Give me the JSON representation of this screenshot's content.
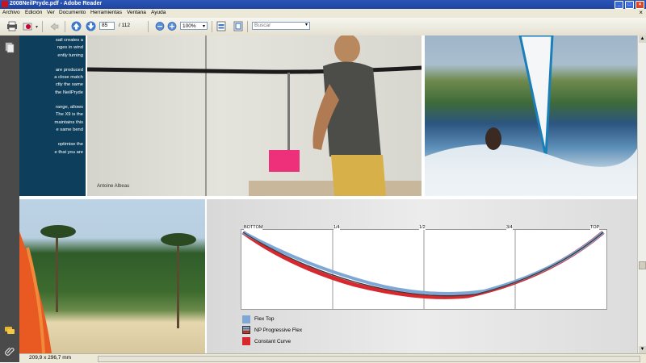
{
  "window": {
    "title": "2008NeilPryde.pdf - Adobe Reader"
  },
  "menu": [
    "Archivo",
    "Edición",
    "Ver",
    "Documento",
    "Herramientas",
    "Ventana",
    "Ayuda"
  ],
  "toolbar": {
    "page_current": "85",
    "page_total": "/ 112",
    "zoom": "100%",
    "search_placeholder": "Buscar"
  },
  "document": {
    "text_lines": [
      "sail creates a",
      "nges in wind",
      "ently turning",
      "are produced",
      "a close match",
      "ctly the same",
      "the NeilPryde",
      "range, allows",
      "The X9 is the",
      "maintains this",
      "e same bend",
      "optimise the",
      "e that you are"
    ],
    "photo_caption": "Antoine Albeau",
    "flex_chart": {
      "labels": [
        "BOTTOM",
        "1/4",
        "1/2",
        "3/4",
        "TOP"
      ],
      "legend": [
        {
          "label": "Flex Top",
          "color": "#7fa7d6"
        },
        {
          "label": "NP Progressive Flex",
          "color": "#6b6b6b"
        },
        {
          "label": "Constant Curve",
          "color": "#d7282f"
        }
      ]
    }
  },
  "status": {
    "page_size": "209,9 x 296,7 mm"
  },
  "colors": {
    "panel_navy": "#0d3f5c",
    "title_blue": "#2b56b7",
    "curve_red": "#d7282f",
    "curve_blue": "#7fa7d6"
  }
}
